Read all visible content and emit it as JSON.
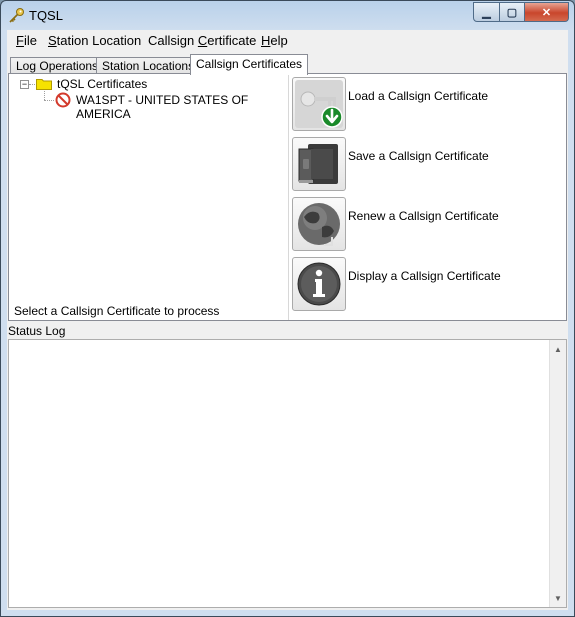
{
  "window": {
    "title": "TQSL"
  },
  "menu": [
    {
      "prefix": "",
      "accel": "F",
      "rest": "ile"
    },
    {
      "prefix": "",
      "accel": "S",
      "rest": "tation Location"
    },
    {
      "prefix": "Callsign ",
      "accel": "C",
      "rest": "ertificate"
    },
    {
      "prefix": "",
      "accel": "H",
      "rest": "elp"
    }
  ],
  "tabs": [
    "Log Operations",
    "Station Locations",
    "Callsign Certificates"
  ],
  "active_tab": 2,
  "tree": {
    "root_label": "tQSL Certificates",
    "child_label": "WA1SPT - UNITED STATES OF AMERICA",
    "expander": "−"
  },
  "tree_status": "Select a Callsign Certificate to process",
  "actions": [
    {
      "label": "Load a Callsign Certificate",
      "icon": "certificate-download-icon"
    },
    {
      "label": "Save a Callsign Certificate",
      "icon": "safe-save-icon"
    },
    {
      "label": "Renew a Callsign Certificate",
      "icon": "globe-renew-icon"
    },
    {
      "label": "Display a Callsign Certificate",
      "icon": "info-icon"
    }
  ],
  "status_log": {
    "label": "Status Log",
    "content": ""
  },
  "colors": {
    "accent_green": "#1a8a2a",
    "error_red": "#d33a2c",
    "folder_yellow": "#f6e200"
  }
}
